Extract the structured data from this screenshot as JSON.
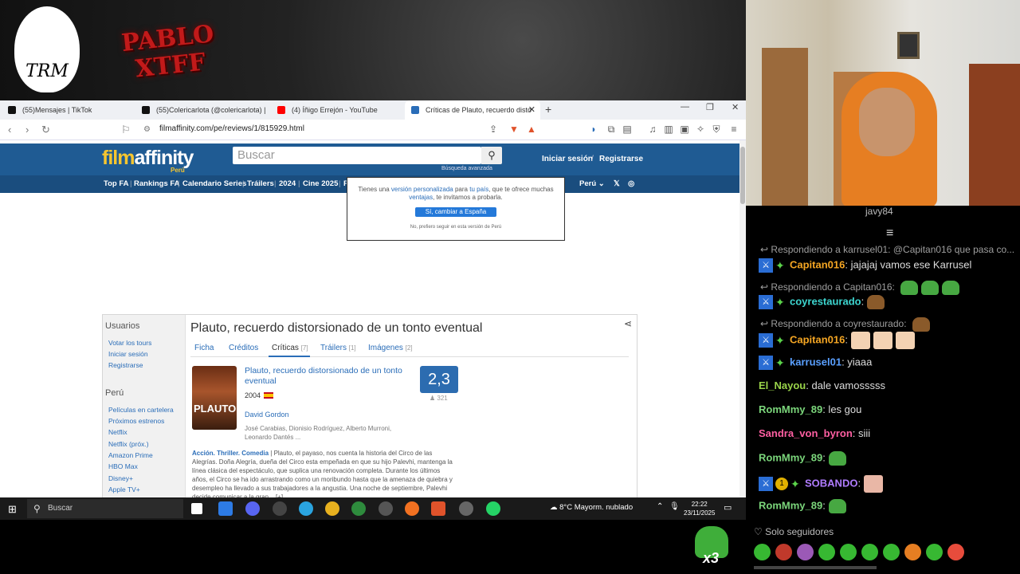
{
  "overlay": {
    "trm_logo": "TRM",
    "pablo_logo": "PABLO XTFF"
  },
  "browser": {
    "tabs": [
      {
        "label": "(55)Mensajes | TikTok",
        "color": "#111111"
      },
      {
        "label": "(55)Colericarlota (@colericarlota) | Ti",
        "color": "#111111"
      },
      {
        "label": "(4) Íñigo Errejón - YouTube",
        "color": "#ff0000"
      },
      {
        "label": "Críticas de Plauto, recuerdo disto",
        "color": "#2a6db8"
      }
    ],
    "url": "filmaffinity.com/pe/reviews/1/815929.html"
  },
  "fa": {
    "logo_film": "film",
    "logo_affinity": "affinity",
    "logo_sub": "Perú",
    "search_placeholder": "Buscar",
    "advanced_search": "Búsqueda avanzada",
    "login": "Iniciar sesión",
    "separator": "/",
    "register": "Registrarse",
    "nav": [
      "Top FA",
      "Rankings FA",
      "Calendario Series",
      "Tráilers",
      "2024",
      "Cine 2025",
      "P"
    ],
    "country": "Perú",
    "popup": {
      "text_a": "Tienes una",
      "link_a": "versión personalizada",
      "text_b": "para",
      "link_b": "tu país",
      "text_c": ", que te ofrece muchas",
      "link_c": "ventajas",
      "text_d": ", te invitamos a probarla.",
      "yes": "Sí, cambiar a España",
      "no": "No, prefiero seguir en esta versión de Perú"
    },
    "sidebar": {
      "users_heading": "Usuarios",
      "users_links": [
        "Votar los tours",
        "Iniciar sesión",
        "Registrarse"
      ],
      "country_heading": "Perú",
      "country_links": [
        "Películas en cartelera",
        "Próximos estrenos",
        "Netflix",
        "Netflix (próx.)",
        "Amazon Prime",
        "HBO Max",
        "Disney+",
        "Apple TV+"
      ]
    },
    "film": {
      "title": "Plauto, recuerdo distorsionado de un tonto eventual",
      "tabs": [
        {
          "label": "Ficha",
          "count": ""
        },
        {
          "label": "Créditos",
          "count": ""
        },
        {
          "label": "Críticas",
          "count": "[7]"
        },
        {
          "label": "Tráilers",
          "count": "[1]"
        },
        {
          "label": "Imágenes",
          "count": "[2]"
        }
      ],
      "poster_text": "PLAUTO",
      "movie_title": "Plauto, recuerdo distorsionado de un tonto eventual",
      "year": "2004",
      "director": "David Gordon",
      "cast": "José Carabias, Dionisio Rodríguez, Alberto Murroni, Leonardo Dantés ...",
      "rating": "2,3",
      "votes": "321",
      "genres": "Acción. Thriller. Comedia",
      "synopsis": "| Plauto, el payaso, nos cuenta la historia del Circo de las Alegrías. Doña Alegría, dueña del Circo esta empeñada en que su hijo Palevhi, mantenga la línea clásica del espectáculo, que suplica una renovación completa. Durante los últimos años, el Circo se ha ido arrastrando como un moribundo hasta que la amenaza de quiebra y desempleo ha llevado a sus trabajadores a la angustia. Una noche de septiembre, Palevhi decide comunicar a la gran... [+]"
    }
  },
  "taskbar": {
    "search": "Buscar",
    "weather": "8°C  Mayorm. nublado",
    "time": "22:22",
    "date": "23/11/2025"
  },
  "chat": {
    "pinned_user": "javy84",
    "lines": [
      {
        "type": "reply",
        "text": "Respondiendo a karrusel01: @Capitan016 que pasa co..."
      },
      {
        "type": "msg",
        "badges": "both",
        "user": "Capitan016",
        "color": "#f5a623",
        "text": ": jajajaj vamos ese Karrusel",
        "emotes": 0
      },
      {
        "type": "reply",
        "text": "Respondiendo a Capitan016:"
      },
      {
        "type": "msg",
        "badges": "both",
        "user": "coyrestaurado",
        "color": "#3dd6d0",
        "text": ":",
        "emotes": 1
      },
      {
        "type": "reply",
        "text": "Respondiendo a coyrestaurado:"
      },
      {
        "type": "msg",
        "badges": "both",
        "user": "Capitan016",
        "color": "#f5a623",
        "text": ":",
        "emotes": 3
      },
      {
        "type": "msg",
        "badges": "both",
        "user": "karrusel01",
        "color": "#5aa0ff",
        "text": ": yiaaa",
        "emotes": 0
      },
      {
        "type": "msg",
        "badges": "none",
        "user": "El_Nayou",
        "color": "#9ad44a",
        "text": ": dale vamosssss",
        "emotes": 0
      },
      {
        "type": "msg",
        "badges": "none",
        "user": "RomMmy_89",
        "color": "#7bd67b",
        "text": ": les gou",
        "emotes": 0
      },
      {
        "type": "msg",
        "badges": "none",
        "user": "Sandra_von_byron",
        "color": "#ff5fa2",
        "text": ": siii",
        "emotes": 0
      },
      {
        "type": "msg",
        "badges": "none",
        "user": "RomMmy_89",
        "color": "#7bd67b",
        "text": ":",
        "emotes": 1
      },
      {
        "type": "msg",
        "badges": "gold",
        "user": "SOBANDO",
        "color": "#b07cff",
        "text": ":",
        "emotes": 1
      },
      {
        "type": "msg",
        "badges": "none",
        "user": "RomMmy_89",
        "color": "#7bd67b",
        "text": ":",
        "emotes": 1
      }
    ],
    "followers": "Solo seguidores",
    "emote_count": "x3"
  }
}
